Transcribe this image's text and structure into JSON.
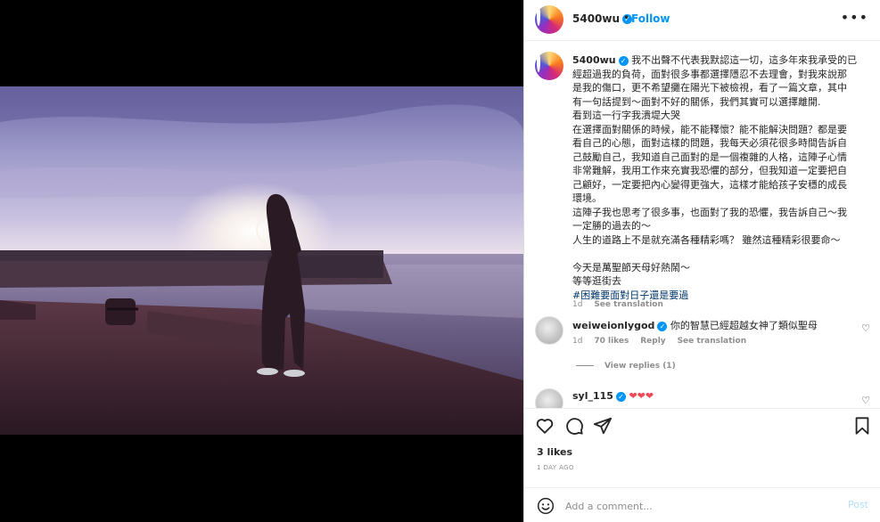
{
  "post": {
    "username": "5400wu",
    "follow_label": "Follow",
    "dot": "•",
    "more": "•••"
  },
  "caption": {
    "username": "5400wu",
    "lines": [
      "我不出聲不代表我默認這一切，這多年來我承受的已",
      "經超過我的負荷，面對很多事都選擇隱忍不去理會，對我來說那",
      "是我的傷口，更不希望攤在陽光下被檢視，看了一篇文章，其中",
      "有一句話提到～面對不好的關係，我們其實可以選擇離開.",
      "看到這一行字我潰堤大哭",
      "在選擇面對關係的時候，能不能釋懷？能不能解決問題？都是要",
      "看自己的心態，面對這樣的問題，我每天必須花很多時間告訴自",
      "己鼓勵自己，我知道自己面對的是一個複雜的人格，這陣子心情",
      "非常難解，我用工作來充實我恐懼的部分，但我知道一定要把自",
      "己顧好，一定要把內心變得更強大，這樣才能給孩子安穩的成長",
      "環境。",
      "這陣子我也思考了很多事，也面對了我的恐懼，我告訴自己～我",
      "一定勝的過去的～",
      "人生的道路上不是就充滿各種精彩嗎？ 雖然這種精彩很要命～",
      "",
      "今天是萬聖節天母好熱鬧～",
      "等等逛街去"
    ],
    "hashtag": "#困難要面對日子還是要過",
    "time": "1d",
    "see_translation": "See translation"
  },
  "comments": [
    {
      "username": "weiweionlygod",
      "text": "你的智慧已經超越女神了類似聖母",
      "time": "1d",
      "likes": "70 likes",
      "reply": "Reply",
      "see_translation": "See translation",
      "view_replies": "View replies (1)"
    },
    {
      "username": "syl_115",
      "text": "❤❤❤"
    }
  ],
  "footer": {
    "likes": "3 likes",
    "date": "1 DAY AGO",
    "comment_placeholder": "Add a comment...",
    "post_label": "Post"
  },
  "icons": {
    "verified": "✓",
    "heart_small": "♡"
  }
}
